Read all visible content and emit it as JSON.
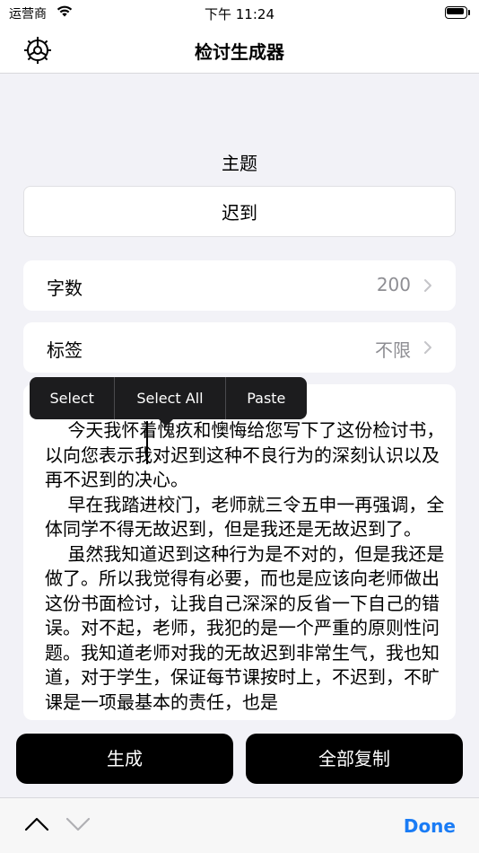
{
  "status_bar": {
    "carrier": "运营商",
    "time": "下午 11:24"
  },
  "nav": {
    "title": "检讨生成器",
    "settings_icon": "gear-icon"
  },
  "form": {
    "topic_label": "主题",
    "topic_value": "迟到",
    "word_count_label": "字数",
    "word_count_value": "200",
    "tag_label": "标签",
    "tag_value": "不限"
  },
  "context_menu": {
    "select": "Select",
    "select_all": "Select All",
    "paste": "Paste"
  },
  "text_area": {
    "content": "    今天我怀着愧疚和懊悔给您写下了这份检讨书，以向您表示我对迟到这种不良行为的深刻认识以及再不迟到的决心。\n    早在我踏进校门，老师就三令五申一再强调，全体同学不得无故迟到，但是我还是无故迟到了。\n    虽然我知道迟到这种行为是不对的，但是我还是做了。所以我觉得有必要，而也是应该向老师做出这份书面检讨，让我自己深深的反省一下自己的错误。对不起，老师，我犯的是一个严重的原则性问题。我知道老师对我的无故迟到非常生气，我也知道，对于学生，保证每节课按时上，不迟到，不旷课是一项最基本的责任，也是"
  },
  "buttons": {
    "generate": "生成",
    "copy_all": "全部复制"
  },
  "accessory": {
    "done": "Done"
  },
  "colors": {
    "accent": "#1a7cf5",
    "background": "#f2f2f7",
    "secondary_text": "#8e8e93"
  }
}
